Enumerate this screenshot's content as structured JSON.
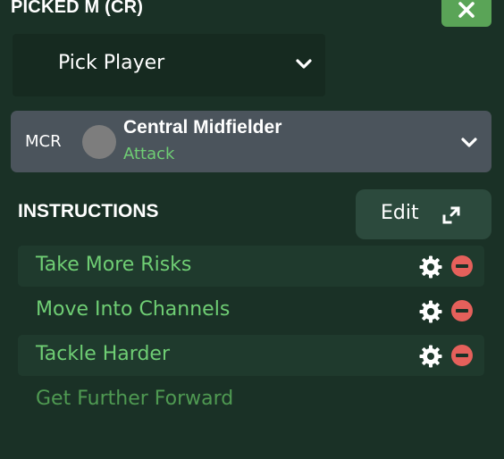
{
  "panel": {
    "title": "PICKED M (CR)",
    "close_icon": "close-icon"
  },
  "picker": {
    "label": "Pick Player",
    "icon": "chevron-down-icon"
  },
  "role": {
    "position": "MCR",
    "name": "Central Midfielder",
    "duty": "Attack",
    "icon": "chevron-down-icon"
  },
  "instructions": {
    "title": "INSTRUCTIONS",
    "edit_label": "Edit",
    "edit_icon": "expand-icon",
    "items": [
      {
        "label": "Take More Risks",
        "active": true
      },
      {
        "label": "Move Into Channels",
        "active": true
      },
      {
        "label": "Tackle Harder",
        "active": true
      },
      {
        "label": "Get Further Forward",
        "active": false
      }
    ]
  },
  "colors": {
    "background": "#1a3126",
    "accent_green": "#6fce74",
    "close_button": "#5aa457",
    "remove_red": "#e5605b",
    "role_card": "#4b545c"
  }
}
